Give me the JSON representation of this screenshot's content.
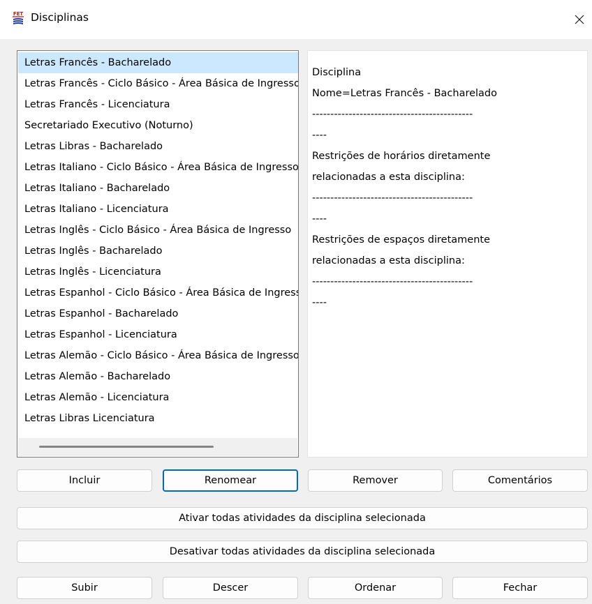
{
  "window": {
    "title": "Disciplinas",
    "icon": "fet-app-icon",
    "close_glyph": "✕"
  },
  "subjects": {
    "items": [
      "Letras Francês - Bacharelado",
      "Letras Francês - Ciclo Básico - Área Básica de Ingresso",
      "Letras Francês - Licenciatura",
      "Secretariado Executivo (Noturno)",
      "Letras Libras - Bacharelado",
      "Letras Italiano - Ciclo Básico - Área Básica de Ingresso",
      "Letras Italiano - Bacharelado",
      "Letras Italiano - Licenciatura",
      "Letras Inglês - Ciclo Básico - Área Básica de Ingresso",
      "Letras Inglês - Bacharelado",
      "Letras Inglês - Licenciatura",
      "Letras Espanhol - Ciclo Básico - Área Básica de Ingresso",
      "Letras Espanhol - Bacharelado",
      "Letras Espanhol - Licenciatura",
      "Letras Alemão - Ciclo Básico - Área Básica de Ingresso",
      "Letras Alemão - Bacharelado",
      "Letras Alemão - Licenciatura",
      "Letras Libras Licenciatura"
    ],
    "selected_index": 0
  },
  "details": {
    "lines": [
      "Disciplina",
      "Nome=Letras Francês - Bacharelado",
      "--------------------------------------------",
      "----",
      "Restrições de horários diretamente",
      "relacionadas a esta disciplina:",
      "--------------------------------------------",
      "----",
      "Restrições de espaços diretamente",
      "relacionadas a esta disciplina:",
      "--------------------------------------------",
      "----"
    ]
  },
  "buttons": {
    "add": "Incluir",
    "rename": "Renomear",
    "remove": "Remover",
    "comments": "Comentários",
    "activate_all": "Ativar todas atividades da disciplina selecionada",
    "deactivate_all": "Desativar todas atividades da disciplina selecionada",
    "move_up": "Subir",
    "move_down": "Descer",
    "sort": "Ordenar",
    "close": "Fechar"
  },
  "colors": {
    "selection": "#cce8ff",
    "focus_border": "#0067c0",
    "window_bg": "#f0f0f0"
  }
}
